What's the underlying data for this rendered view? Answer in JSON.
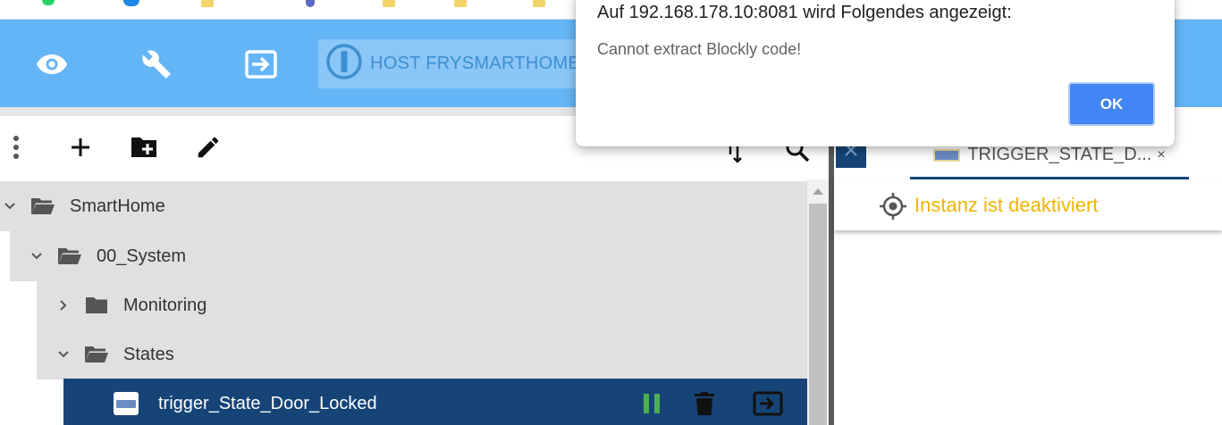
{
  "header": {
    "host_label": "HOST FRYSMARTHOME",
    "icons": [
      "eye-icon",
      "wrench-icon",
      "exit-to-app-icon"
    ]
  },
  "toolbar": {
    "icons": [
      "more-vert-icon",
      "add-icon",
      "create-folder-icon",
      "edit-icon",
      "sort-icon",
      "search-icon"
    ]
  },
  "tree": {
    "items": [
      {
        "label": "SmartHome",
        "expanded": true,
        "level": 0
      },
      {
        "label": "00_System",
        "expanded": true,
        "level": 1
      },
      {
        "label": "Monitoring",
        "expanded": false,
        "level": 2
      },
      {
        "label": "States",
        "expanded": true,
        "level": 2
      },
      {
        "label": "trigger_State_Door_Locked",
        "type": "script",
        "selected": true,
        "level": 3
      }
    ]
  },
  "editor": {
    "tab_label": "TRIGGER_STATE_D...",
    "tab_close": "×",
    "status_text": "Instanz ist deaktiviert"
  },
  "dialog": {
    "title": "Auf 192.168.178.10:8081 wird Folgendes angezeigt:",
    "message": "Cannot extract Blockly code!",
    "ok_label": "OK"
  },
  "colors": {
    "header_blue": "#64b5f6",
    "selected_row": "#164477",
    "status_warning": "#f0b400",
    "ok_button": "#4285f4",
    "pause_green": "#4caf50"
  }
}
